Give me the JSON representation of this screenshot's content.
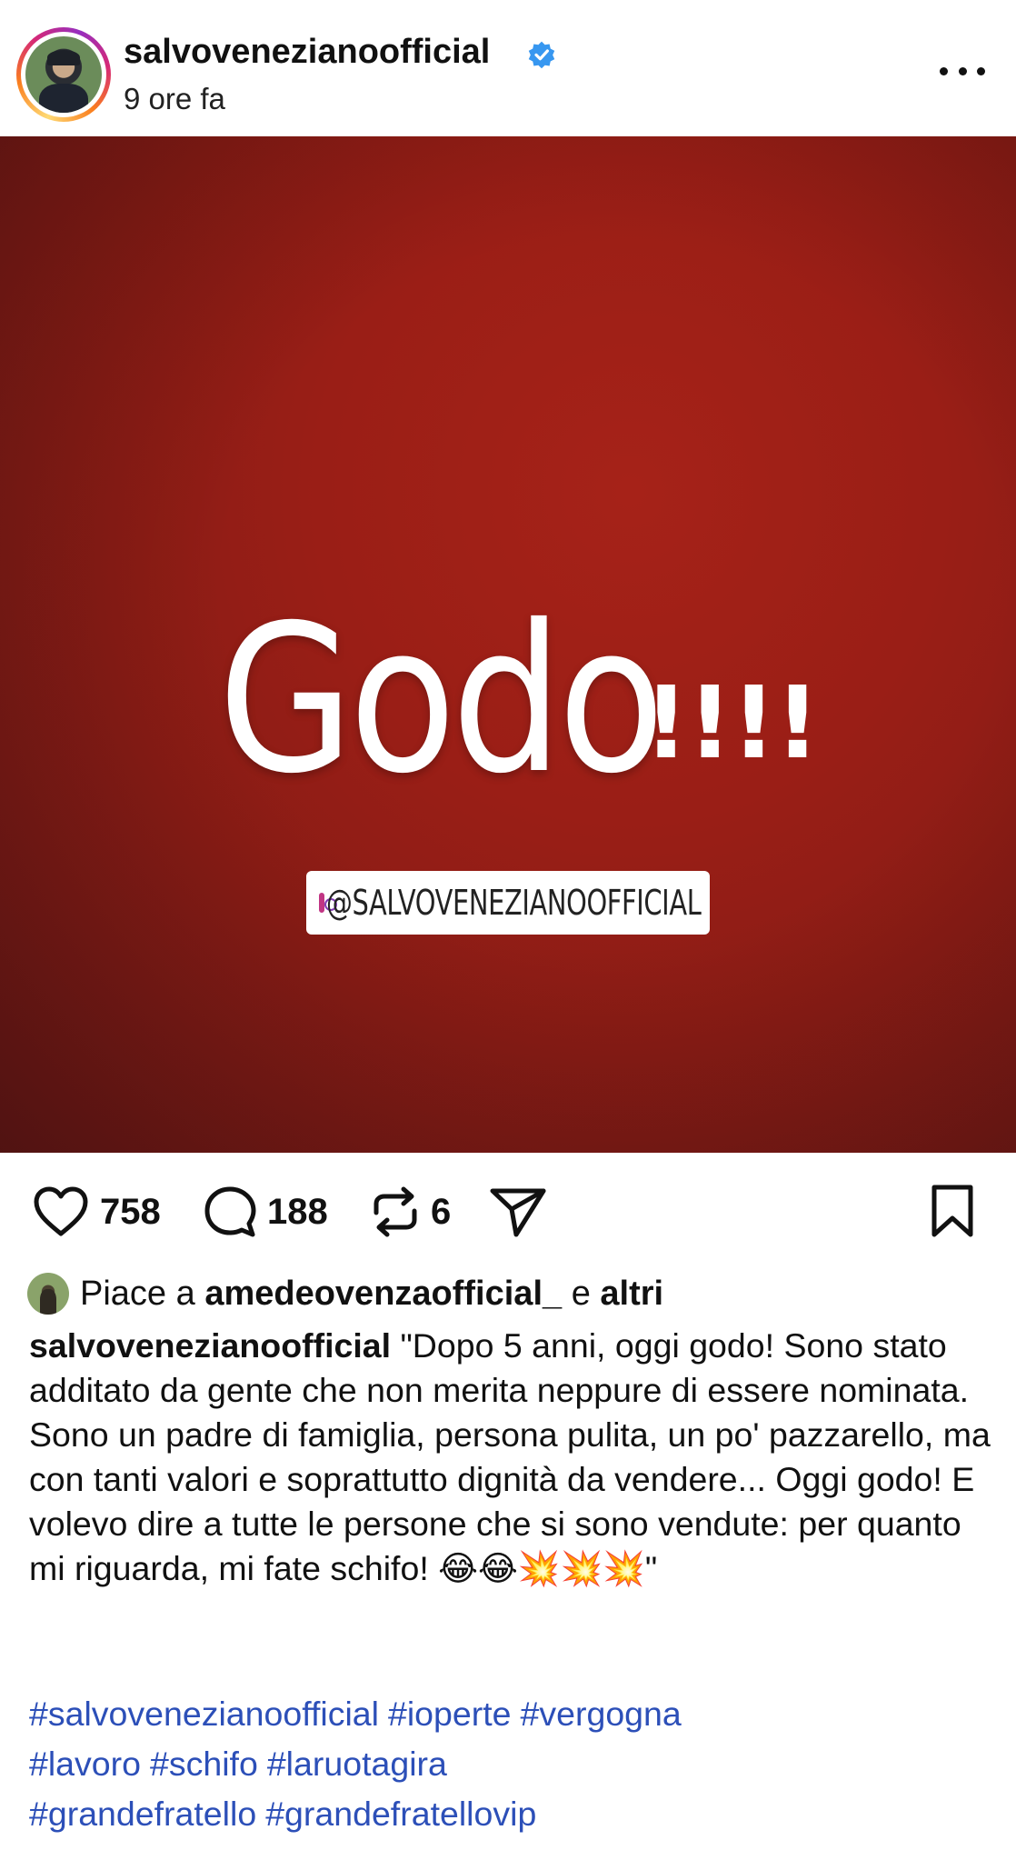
{
  "header": {
    "username": "salvovenezianoofficial",
    "time": "9 ore fa",
    "verified_color": "#3797f0"
  },
  "media": {
    "title": "Godo",
    "exclaim": "!!!!",
    "tag": "@SALVOVENEZIANOOFFICIAL",
    "background_color": "#9a1e16",
    "muted": true
  },
  "actions": {
    "likes": "758",
    "comments": "188",
    "reposts": "6",
    "icons": [
      "heart-icon",
      "comment-icon",
      "repost-icon",
      "share-icon",
      "bookmark-icon"
    ]
  },
  "liked_by": {
    "prefix": "Piace a",
    "user": "amedeovenzaofficial_",
    "joiner": "e",
    "others": "altri"
  },
  "caption": {
    "user": "salvovenezianoofficial",
    "text": "\"Dopo 5 anni, oggi godo! Sono stato additato da gente che non merita neppure di essere nominata. Sono un padre di famiglia, persona pulita, un po' pazzarello, ma con tanti valori e soprattutto dignità da vendere... Oggi godo! E volevo dire  a tutte le persone che si sono vendute: per quanto mi riguarda, mi fate schifo! 😂😂💥💥💥\""
  },
  "hashtags": [
    "#salvovenezianoofficial",
    "#ioperte",
    "#vergogna",
    "#lavoro",
    "#schifo",
    "#laruotagira",
    "#grandefratello",
    "#grandefratellovip"
  ]
}
